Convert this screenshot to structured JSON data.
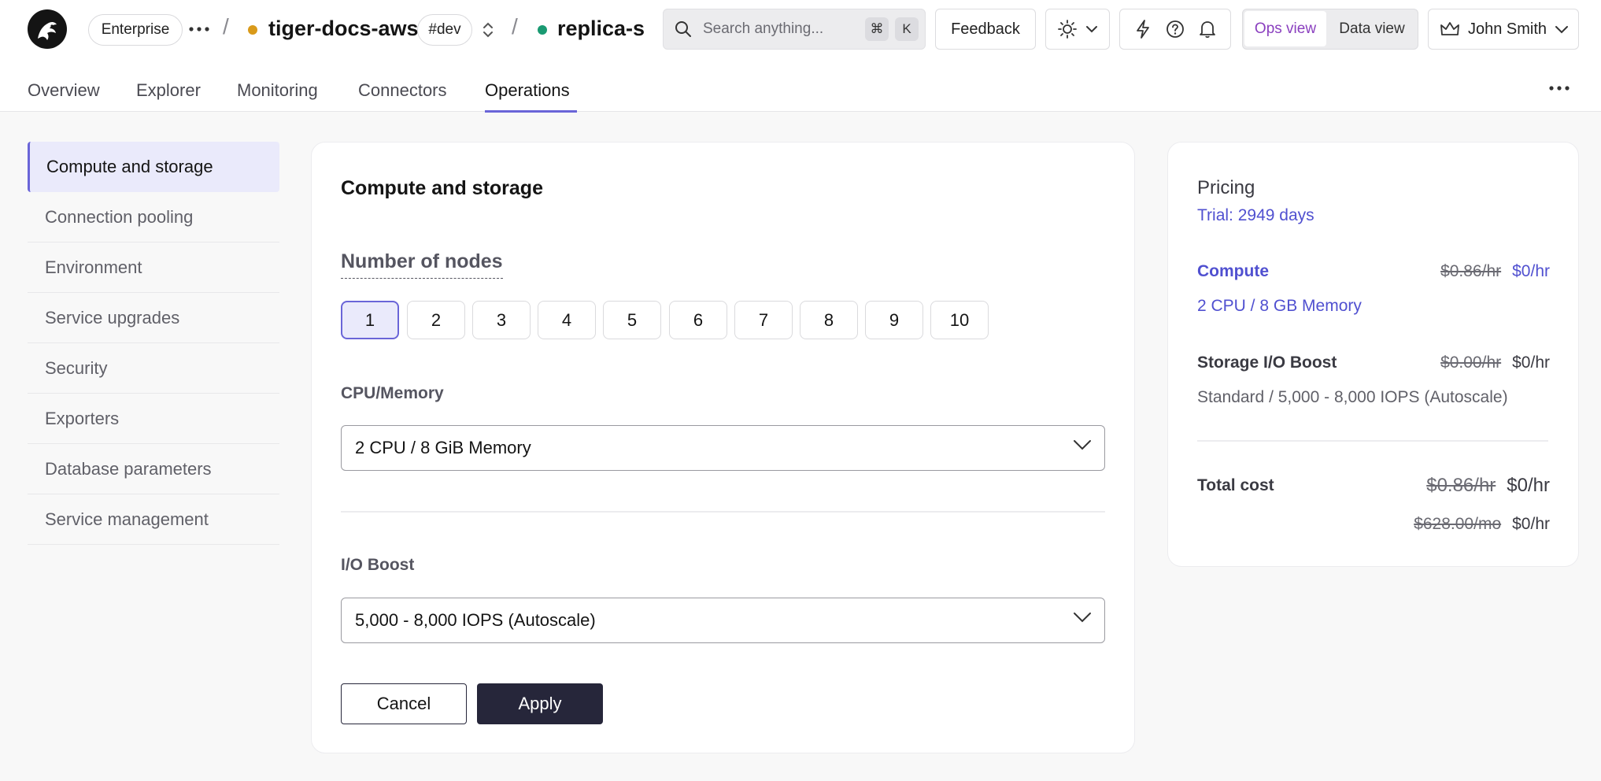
{
  "header": {
    "plan_badge": "Enterprise",
    "project_name": "tiger-docs-aws",
    "project_tag": "#dev",
    "service_name": "replica-se",
    "search_placeholder": "Search anything...",
    "search_key_1": "⌘",
    "search_key_2": "K",
    "feedback_label": "Feedback",
    "view_ops": "Ops view",
    "view_data": "Data view",
    "user_name": "John Smith",
    "project_status_color": "#d99a1a",
    "service_status_color": "#1a9a72"
  },
  "tabs": [
    {
      "label": "Overview"
    },
    {
      "label": "Explorer"
    },
    {
      "label": "Monitoring"
    },
    {
      "label": "Connectors"
    },
    {
      "label": "Operations",
      "active": true
    }
  ],
  "sidebar": {
    "items": [
      {
        "label": "Compute and storage",
        "active": true
      },
      {
        "label": "Connection pooling"
      },
      {
        "label": "Environment"
      },
      {
        "label": "Service upgrades"
      },
      {
        "label": "Security"
      },
      {
        "label": "Exporters"
      },
      {
        "label": "Database parameters"
      },
      {
        "label": "Service management"
      }
    ]
  },
  "main": {
    "title": "Compute and storage",
    "nodes_label": "Number of nodes",
    "nodes": [
      "1",
      "2",
      "3",
      "4",
      "5",
      "6",
      "7",
      "8",
      "9",
      "10"
    ],
    "nodes_selected": "1",
    "cpu_label": "CPU/Memory",
    "cpu_value": "2 CPU / 8 GiB Memory",
    "io_label": "I/O Boost",
    "io_value": "5,000 - 8,000 IOPS (Autoscale)",
    "cancel_label": "Cancel",
    "apply_label": "Apply"
  },
  "pricing": {
    "title": "Pricing",
    "trial": "Trial: 2949 days",
    "compute_label": "Compute",
    "compute_old": "$0.86/hr",
    "compute_new": "$0/hr",
    "compute_desc": "2 CPU / 8 GB Memory",
    "storage_label": "Storage I/O Boost",
    "storage_old": "$0.00/hr",
    "storage_new": "$0/hr",
    "storage_desc": "Standard / 5,000 - 8,000 IOPS (Autoscale)",
    "total_label": "Total cost",
    "total_old_hr": "$0.86/hr",
    "total_new_hr": "$0/hr",
    "total_old_mo": "$628.00/mo",
    "total_new_mo": "$0/hr"
  },
  "colors": {
    "accent": "#6a65d8",
    "apply_bg": "#26263a"
  }
}
